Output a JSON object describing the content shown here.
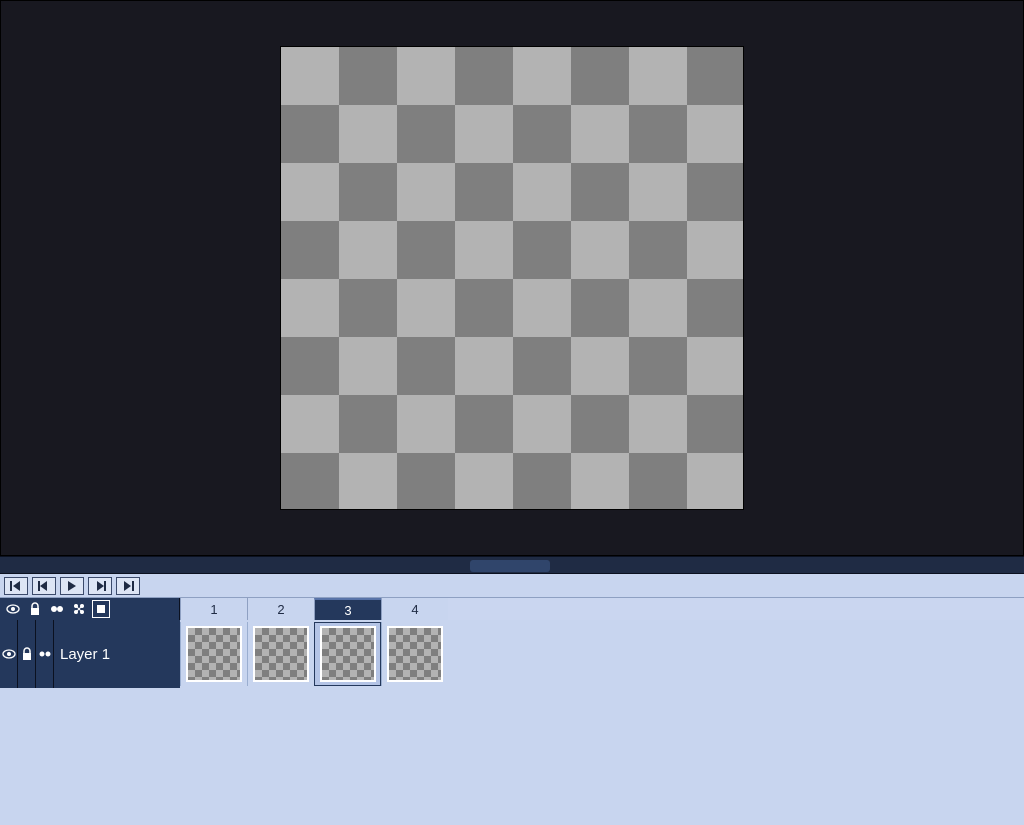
{
  "canvas": {
    "checker_squares": 8
  },
  "playback": {
    "first": "first-frame",
    "prev": "previous-frame",
    "play": "play",
    "next": "next-frame",
    "last": "last-frame"
  },
  "timeline_tools": {
    "eye": "toggle-visibility",
    "lock": "toggle-lock",
    "onion": "onion-skin",
    "link": "link-cels",
    "newframe": "frame-options"
  },
  "frames": [
    {
      "number": "1",
      "selected": false
    },
    {
      "number": "2",
      "selected": false
    },
    {
      "number": "3",
      "selected": true
    },
    {
      "number": "4",
      "selected": false
    }
  ],
  "layers": [
    {
      "name": "Layer 1",
      "visible": true,
      "locked": false,
      "continuous": false
    }
  ]
}
